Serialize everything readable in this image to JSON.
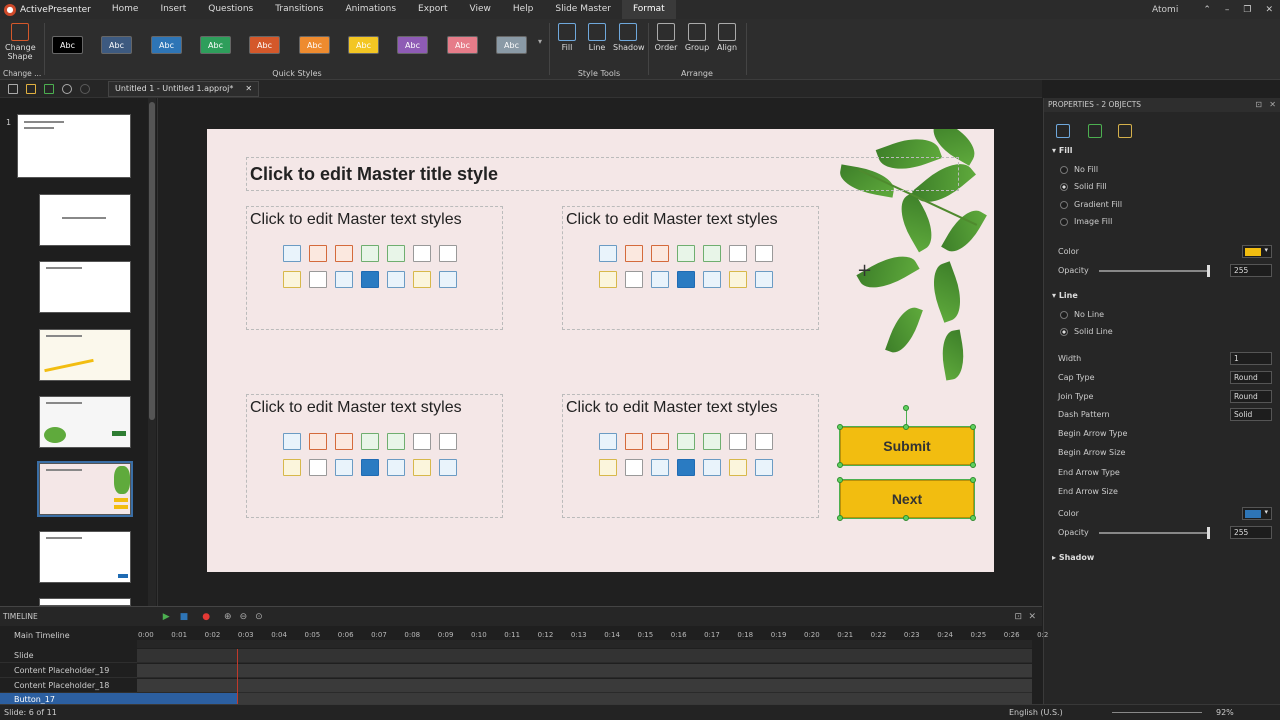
{
  "app": {
    "name": "ActivePresenter",
    "user": "Atomi"
  },
  "menu": [
    "Home",
    "Insert",
    "Questions",
    "Transitions",
    "Animations",
    "Export",
    "View",
    "Help",
    "Slide Master",
    "Format"
  ],
  "ribbon": {
    "change_shape": "Change Shape",
    "change_label": "Change ...",
    "quick_styles_label": "Quick Styles",
    "quick_styles": [
      {
        "label": "Abc",
        "color": "#000000"
      },
      {
        "label": "Abc",
        "color": "#3d5a80"
      },
      {
        "label": "Abc",
        "color": "#2e75b6"
      },
      {
        "label": "Abc",
        "color": "#2e9e5b"
      },
      {
        "label": "Abc",
        "color": "#d4582a"
      },
      {
        "label": "Abc",
        "color": "#ee8b2f"
      },
      {
        "label": "Abc",
        "color": "#f3c623"
      },
      {
        "label": "Abc",
        "color": "#8e5bb5"
      },
      {
        "label": "Abc",
        "color": "#e67c89"
      },
      {
        "label": "Abc",
        "color": "#8a9aa6"
      }
    ],
    "style_tools": [
      "Fill",
      "Line",
      "Shadow"
    ],
    "style_tools_label": "Style Tools",
    "arrange": [
      "Order",
      "Group",
      "Align"
    ],
    "arrange_label": "Arrange"
  },
  "doc_tab": "Untitled 1 - Untitled 1.approj*",
  "slide_number": "1",
  "slide": {
    "title": "Click to edit Master title style",
    "placeholder_text": "Click to edit Master text styles",
    "buttons": [
      "Submit",
      "Next"
    ]
  },
  "properties": {
    "header": "PROPERTIES - 2 OBJECTS",
    "fill_section": "Fill",
    "fill_options": [
      "No Fill",
      "Solid Fill",
      "Gradient Fill",
      "Image Fill"
    ],
    "fill_color_label": "Color",
    "fill_color": "#f2bd10",
    "opacity_label": "Opacity",
    "fill_opacity": "255",
    "line_section": "Line",
    "line_options": [
      "No Line",
      "Solid Line"
    ],
    "width_label": "Width",
    "width": "1",
    "cap_type_label": "Cap Type",
    "cap_type": "Round",
    "join_type_label": "Join Type",
    "join_type": "Round",
    "dash_label": "Dash Pattern",
    "dash": "Solid",
    "begin_arrow_type": "Begin Arrow Type",
    "begin_arrow_size": "Begin Arrow Size",
    "end_arrow_type": "End Arrow Type",
    "end_arrow_size": "End Arrow Size",
    "line_color_label": "Color",
    "line_color": "#2e75b6",
    "line_opacity": "255",
    "shadow_section": "Shadow"
  },
  "timeline": {
    "title": "TIMELINE",
    "main": "Main Timeline",
    "ticks": [
      "0:00",
      "0:01",
      "0:02",
      "0:03",
      "0:04",
      "0:05",
      "0:06",
      "0:07",
      "0:08",
      "0:09",
      "0:10",
      "0:11",
      "0:12",
      "0:13",
      "0:14",
      "0:15",
      "0:16",
      "0:17",
      "0:18",
      "0:19",
      "0:20",
      "0:21",
      "0:22",
      "0:23",
      "0:24",
      "0:25",
      "0:26",
      "0:2"
    ],
    "rows": [
      "Slide",
      "Content Placeholder_19",
      "Content Placeholder_18",
      "Button_17"
    ]
  },
  "status": {
    "slide": "Slide: 6 of 11",
    "language": "English (U.S.)",
    "zoom": "92%"
  }
}
